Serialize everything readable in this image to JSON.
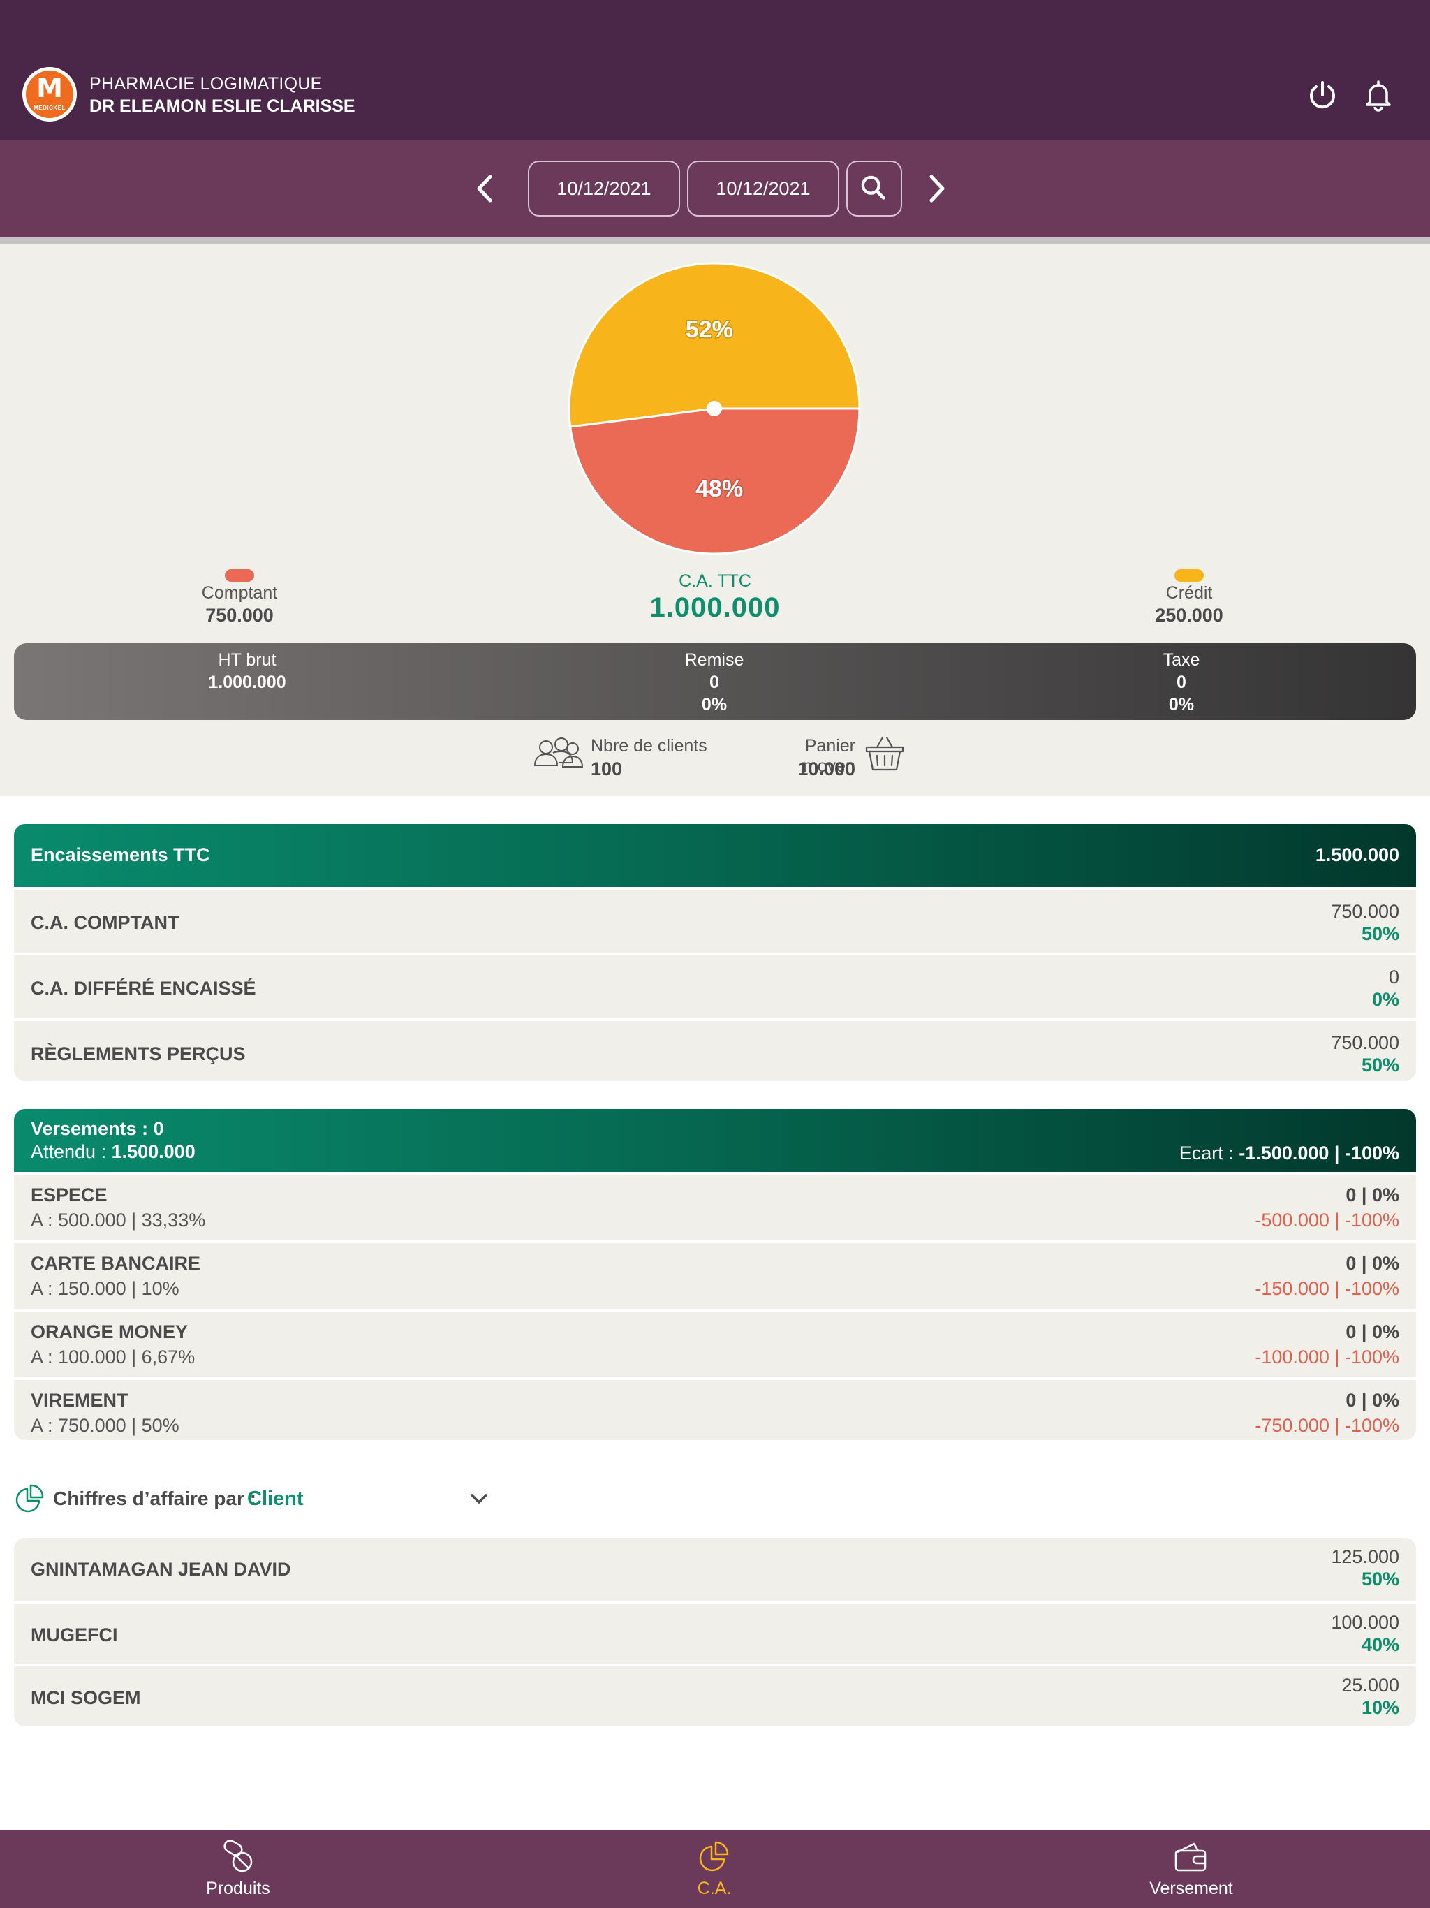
{
  "header": {
    "pharmacy_name": "PHARMACIE LOGIMATIQUE",
    "owner_name": "DR ELEAMON ESLIE CLARISSE",
    "logo_letter": "M",
    "logo_text": "MEDICKEL"
  },
  "date_filter": {
    "from": "10/12/2021",
    "to": "10/12/2021"
  },
  "chart_data": {
    "type": "pie",
    "slices": [
      {
        "label": "Crédit",
        "percent": 52,
        "display": "52%",
        "color": "#f8b41b"
      },
      {
        "label": "Comptant",
        "percent": 48,
        "display": "48%",
        "color": "#ea6a56"
      }
    ]
  },
  "summary": {
    "comptant_label": "Comptant",
    "comptant_value": "750.000",
    "ca_label": "C.A. TTC",
    "ca_value": "1.000.000",
    "credit_label": "Crédit",
    "credit_value": "250.000",
    "colors": {
      "comptant": "#ea6a56",
      "credit": "#f8b41b",
      "accent": "#0c8f6c"
    }
  },
  "ht_bar": {
    "ht_label": "HT brut",
    "ht_value": "1.000.000",
    "remise_label": "Remise",
    "remise_value": "0",
    "remise_pct": "0%",
    "taxe_label": "Taxe",
    "taxe_value": "0",
    "taxe_pct": "0%"
  },
  "stats": {
    "clients_label": "Nbre de clients",
    "clients_value": "100",
    "basket_label": "Panier moyen",
    "basket_value": "10.000"
  },
  "encaissements": {
    "title": "Encaissements TTC",
    "total": "1.500.000",
    "rows": [
      {
        "label": "C.A. COMPTANT",
        "value": "750.000",
        "pct": "50%"
      },
      {
        "label": "C.A. DIFFÉRÉ ENCAISSÉ",
        "value": "0",
        "pct": "0%"
      },
      {
        "label": "RÈGLEMENTS PERÇUS",
        "value": "750.000",
        "pct": "50%"
      }
    ]
  },
  "versements": {
    "title": "Versements : 0",
    "attendu_label": "Attendu : ",
    "attendu_value": "1.500.000",
    "ecart_label": "Ecart : ",
    "ecart_value": "-1.500.000 | -100%",
    "rows": [
      {
        "label": "ESPECE",
        "sub": "A : 500.000 | 33,33%",
        "right": "0 | 0%",
        "diff": "-500.000 | -100%"
      },
      {
        "label": "CARTE BANCAIRE",
        "sub": "A : 150.000 | 10%",
        "right": "0 | 0%",
        "diff": "-150.000 | -100%"
      },
      {
        "label": "ORANGE MONEY",
        "sub": "A : 100.000 | 6,67%",
        "right": "0 | 0%",
        "diff": "-100.000 | -100%"
      },
      {
        "label": "VIREMENT",
        "sub": "A : 750.000 | 50%",
        "right": "0 | 0%",
        "diff": "-750.000 | -100%"
      }
    ]
  },
  "ca_par": {
    "label": "Chiffres d’affaire par :",
    "selected": "Client",
    "rows": [
      {
        "label": "GNINTAMAGAN JEAN DAVID",
        "value": "125.000",
        "pct": "50%"
      },
      {
        "label": "MUGEFCI",
        "value": "100.000",
        "pct": "40%"
      },
      {
        "label": "MCI SOGEM",
        "value": "25.000",
        "pct": "10%"
      }
    ]
  },
  "bottom_nav": {
    "items": [
      {
        "label": "Produits",
        "icon": "pills-icon"
      },
      {
        "label": "C.A.",
        "icon": "pie-chart-icon",
        "active": true
      },
      {
        "label": "Versement",
        "icon": "wallet-icon"
      }
    ]
  }
}
